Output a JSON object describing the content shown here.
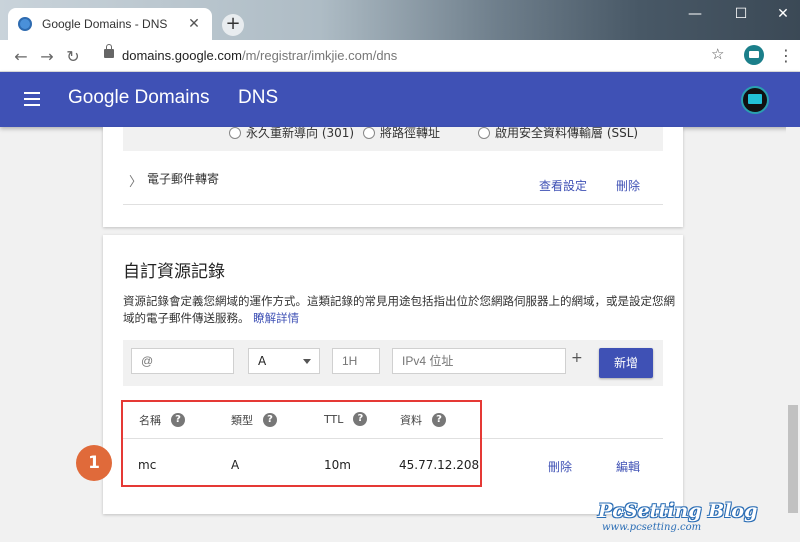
{
  "browser": {
    "tab_title": "Google Domains - DNS",
    "tab_close": "✕",
    "new_tab": "+",
    "window_controls": [
      "—",
      "☐",
      "✕"
    ],
    "url_host": "domains.google.com",
    "url_path": "/m/registrar/imkjie.com/dns",
    "icons": [
      "back-arrow-icon",
      "forward-arrow-icon",
      "reload-icon",
      "lock-icon",
      "star-icon",
      "extension-icon",
      "menu-kebab-icon"
    ]
  },
  "header": {
    "brand": "Google Domains",
    "section": "DNS"
  },
  "forwarding": {
    "radio_options": [
      "永久重新導向 (301)",
      "將路徑轉址",
      "啟用安全資料傳輸層 (SSL)"
    ],
    "email_forwarding_label": "電子郵件轉寄",
    "view_settings": "查看設定",
    "delete": "刪除"
  },
  "custom_records": {
    "title": "自訂資源記錄",
    "description": "資源記錄會定義您網域的運作方式。這類記錄的常見用途包括指出位於您網路伺服器上的網域，或是設定您網域的電子郵件傳送服務。",
    "learn_more": "瞭解詳情",
    "inputs": {
      "name_placeholder": "@",
      "type_value": "A",
      "ttl_placeholder": "1H",
      "data_placeholder": "IPv4 位址"
    },
    "plus": "+",
    "add_button": "新增",
    "columns": [
      "名稱",
      "類型",
      "TTL",
      "資料"
    ],
    "rows": [
      {
        "name": "mc",
        "type": "A",
        "ttl": "10m",
        "data": "45.77.12.208",
        "delete": "刪除",
        "edit": "編輯"
      }
    ]
  },
  "annotation": {
    "step": "1",
    "highlight_color": "#e53935",
    "badge_color": "#e06a3a"
  },
  "watermark": {
    "title": "PcSetting Blog",
    "url": "www.pcsetting.com"
  },
  "colors": {
    "app_bar": "#3f51b5",
    "link": "#3f51b5",
    "page_bg": "#f1f1f1"
  }
}
